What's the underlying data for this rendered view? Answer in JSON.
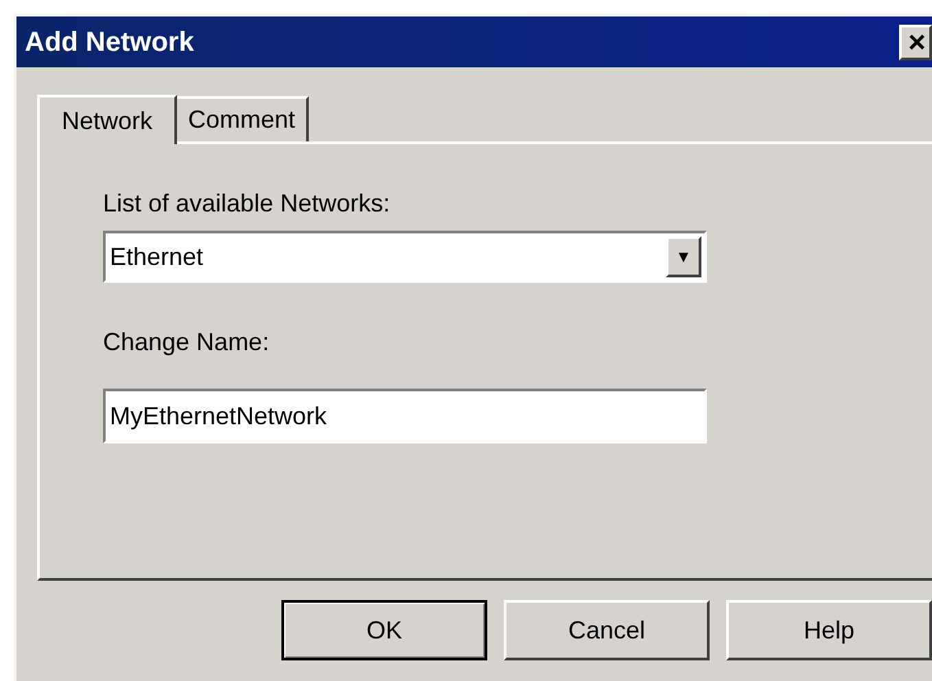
{
  "window": {
    "title": "Add Network",
    "close": "×"
  },
  "tabs": [
    {
      "label": "Network",
      "selected": true
    },
    {
      "label": "Comment",
      "selected": false
    }
  ],
  "network_list": {
    "label": "List of available Networks:",
    "value": "Ethernet",
    "arrow": "▼"
  },
  "change_name": {
    "label": "Change Name:",
    "value": "MyEthernetNetwork"
  },
  "buttons": [
    {
      "label": "OK",
      "default": true
    },
    {
      "label": "Cancel",
      "default": false
    },
    {
      "label": "Help",
      "default": false
    }
  ]
}
